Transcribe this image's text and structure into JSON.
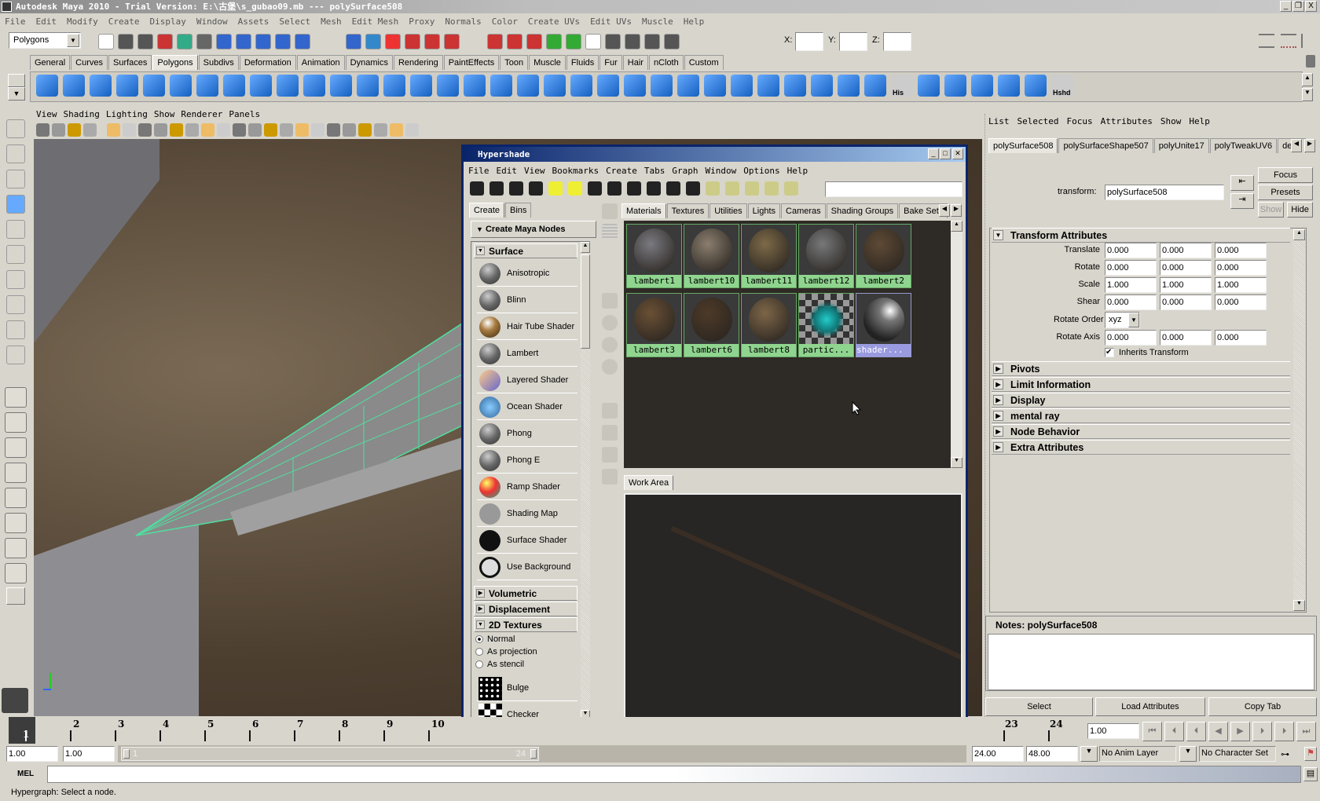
{
  "window": {
    "title": "Autodesk Maya 2010 - Trial Version: E:\\古堡\\s_gubao09.mb   ---   polySurface508",
    "controls": [
      "_",
      "restore",
      "X"
    ]
  },
  "menubar": [
    "File",
    "Edit",
    "Modify",
    "Create",
    "Display",
    "Window",
    "Assets",
    "Select",
    "Mesh",
    "Edit Mesh",
    "Proxy",
    "Normals",
    "Color",
    "Create UVs",
    "Edit UVs",
    "Muscle",
    "Help"
  ],
  "statusline": {
    "menuset": "Polygons",
    "x_label": "X:",
    "y_label": "Y:",
    "z_label": "Z:",
    "x": "",
    "y": "",
    "z": "",
    "icons": [
      "new-scene",
      "open-scene",
      "save-scene",
      "select-hierarchy",
      "select-object",
      "select-component",
      "snap-grid",
      "snap-curve",
      "snap-point",
      "snap-view-plane",
      "make-live",
      "history",
      "render",
      "ipr",
      "render-settings",
      "magnet-a",
      "magnet-b",
      "magnet-c",
      "magnet-d",
      "magnet-e",
      "input-ops",
      "output-ops",
      "construction-history",
      "render-view",
      "render-frame",
      "ipr-render",
      "render-globals"
    ]
  },
  "shelf": {
    "tabs": [
      "General",
      "Curves",
      "Surfaces",
      "Polygons",
      "Subdivs",
      "Deformation",
      "Animation",
      "Dynamics",
      "Rendering",
      "PaintEffects",
      "Toon",
      "Muscle",
      "Fluids",
      "Fur",
      "Hair",
      "nCloth",
      "Custom"
    ],
    "active": "Polygons",
    "icons": [
      "poly-sphere",
      "poly-cube",
      "poly-cylinder",
      "poly-cone",
      "poly-plane",
      "poly-torus",
      "poly-prism",
      "poly-pipe",
      "combine",
      "separate",
      "extract",
      "booleans",
      "smooth",
      "average",
      "mirror",
      "split",
      "insert-loop",
      "offset-loop",
      "append",
      "fill-hole",
      "bridge",
      "extrude",
      "merge",
      "wedge",
      "poke",
      "bevel",
      "sculpt",
      "uv-planar",
      "uv-cylindrical",
      "uv-spherical",
      "uv-auto",
      "uv-editor",
      "his",
      "transfer",
      "triangulate",
      "quadrangulate",
      "reduce-a",
      "reduce-b",
      "hshd"
    ],
    "icon_labels": {
      "his": "His",
      "hshd": "Hshd"
    }
  },
  "viewport": {
    "menu": [
      "View",
      "Shading",
      "Lighting",
      "Show",
      "Renderer",
      "Panels"
    ]
  },
  "hypershade": {
    "title": "Hypershade",
    "menu": [
      "File",
      "Edit",
      "View",
      "Bookmarks",
      "Create",
      "Tabs",
      "Graph",
      "Window",
      "Options",
      "Help"
    ],
    "left_tabs": [
      "Create",
      "Bins"
    ],
    "create_header": "Create Maya Nodes",
    "surface_header": "Surface",
    "surface_nodes": [
      "Anisotropic",
      "Blinn",
      "Hair Tube Shader",
      "Lambert",
      "Layered Shader",
      "Ocean Shader",
      "Phong",
      "Phong E",
      "Ramp Shader",
      "Shading Map",
      "Surface Shader",
      "Use Background"
    ],
    "sections": [
      "Volumetric",
      "Displacement",
      "2D Textures"
    ],
    "texture_modes": [
      "Normal",
      "As projection",
      "As stencil"
    ],
    "texture_mode_selected": "Normal",
    "textures": [
      "Bulge",
      "Checker"
    ],
    "nav": [
      "<<",
      ">>"
    ],
    "tabs": [
      "Materials",
      "Textures",
      "Utilities",
      "Lights",
      "Cameras",
      "Shading Groups",
      "Bake Sets"
    ],
    "active_tab": "Materials",
    "materials": [
      "lambert1",
      "lambert10",
      "lambert11",
      "lambert12",
      "lambert2",
      "lambert3",
      "lambert6",
      "lambert8",
      "partic...",
      "shader..."
    ],
    "selected_material": "shader...",
    "work_area_tab": "Work Area"
  },
  "attribute_editor": {
    "menu": [
      "List",
      "Selected",
      "Focus",
      "Attributes",
      "Show",
      "Help"
    ],
    "tabs": [
      "polySurface508",
      "polySurfaceShape507",
      "polyUnite17",
      "polyTweakUV6",
      "delet"
    ],
    "transform_label": "transform:",
    "transform_value": "polySurface508",
    "buttons": {
      "focus": "Focus",
      "presets": "Presets",
      "show": "Show",
      "hide": "Hide"
    },
    "transform_section": "Transform Attributes",
    "rows": [
      {
        "label": "Translate",
        "values": [
          "0.000",
          "0.000",
          "0.000"
        ]
      },
      {
        "label": "Rotate",
        "values": [
          "0.000",
          "0.000",
          "0.000"
        ]
      },
      {
        "label": "Scale",
        "values": [
          "1.000",
          "1.000",
          "1.000"
        ]
      },
      {
        "label": "Shear",
        "values": [
          "0.000",
          "0.000",
          "0.000"
        ]
      }
    ],
    "rotate_order_label": "Rotate Order",
    "rotate_order": "xyz",
    "rotate_axis": {
      "label": "Rotate Axis",
      "values": [
        "0.000",
        "0.000",
        "0.000"
      ]
    },
    "inherits_transform": "Inherits Transform",
    "inherits_checked": true,
    "sections": [
      "Pivots",
      "Limit Information",
      "Display",
      "mental ray",
      "Node Behavior",
      "Extra Attributes"
    ],
    "notes_label": "Notes:  polySurface508",
    "notes": "",
    "bottom_buttons": [
      "Select",
      "Load Attributes",
      "Copy Tab"
    ]
  },
  "timeline": {
    "ticks": [
      "1",
      "2",
      "3",
      "4",
      "5",
      "6",
      "7",
      "8",
      "9",
      "10",
      "23",
      "24"
    ],
    "current_frame": "1",
    "current_time": "1.00"
  },
  "range": {
    "start": "1.00",
    "playback_start": "1.00",
    "slider_start": "1",
    "slider_end": "24",
    "playback_end": "24.00",
    "end": "48.00",
    "anim_layer": "No Anim Layer",
    "character_set": "No Character Set"
  },
  "command_line": {
    "label": "MEL",
    "value": ""
  },
  "help_line": "Hypergraph: Select a node.",
  "colors": {
    "accent": "#0a246a",
    "material_label": "#8fd48f",
    "selected_material": "#9a9ae0",
    "wireframe": "#4fe0a0"
  }
}
